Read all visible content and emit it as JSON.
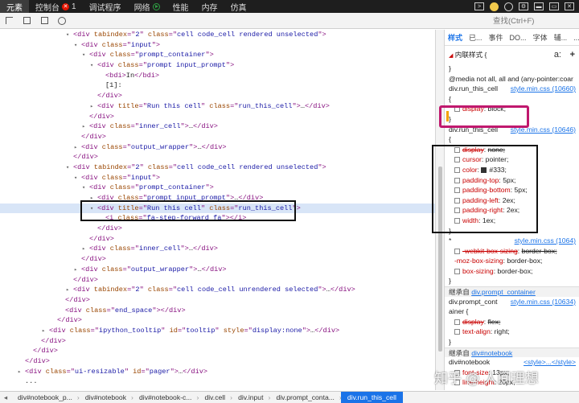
{
  "topbar": {
    "tabs": [
      {
        "label": "元素",
        "active": true
      },
      {
        "label": "控制台",
        "badge": "1",
        "badge_type": "error"
      },
      {
        "label": "调试程序"
      },
      {
        "label": "网络",
        "badge_type": "play"
      },
      {
        "label": "性能"
      },
      {
        "label": "内存"
      },
      {
        "label": "仿真"
      }
    ]
  },
  "toolbar": {
    "search_placeholder": "查找(Ctrl+F)"
  },
  "dom_tree": [
    {
      "indent": 8,
      "tw": "▾",
      "parts": [
        [
          "t",
          "<div "
        ],
        [
          "n",
          "tabindex"
        ],
        [
          "t",
          "=\""
        ],
        [
          "v",
          "2"
        ],
        [
          "t",
          "\" "
        ],
        [
          "n",
          "class"
        ],
        [
          "t",
          "=\""
        ],
        [
          "v",
          "cell code_cell rendered unselected"
        ],
        [
          "t",
          "\">"
        ]
      ]
    },
    {
      "indent": 9,
      "tw": "▾",
      "parts": [
        [
          "t",
          "<div "
        ],
        [
          "n",
          "class"
        ],
        [
          "t",
          "=\""
        ],
        [
          "v",
          "input"
        ],
        [
          "t",
          "\">"
        ]
      ]
    },
    {
      "indent": 10,
      "tw": "▾",
      "parts": [
        [
          "t",
          "<div "
        ],
        [
          "n",
          "class"
        ],
        [
          "t",
          "=\""
        ],
        [
          "v",
          "prompt_container"
        ],
        [
          "t",
          "\">"
        ]
      ]
    },
    {
      "indent": 11,
      "tw": "▾",
      "parts": [
        [
          "t",
          "<div "
        ],
        [
          "n",
          "class"
        ],
        [
          "t",
          "=\""
        ],
        [
          "v",
          "prompt input_prompt"
        ],
        [
          "t",
          "\">"
        ]
      ]
    },
    {
      "indent": 12,
      "tw": "",
      "parts": [
        [
          "t",
          "<bdi>"
        ],
        [
          "x",
          "In"
        ],
        [
          "t",
          "</bdi>"
        ]
      ]
    },
    {
      "indent": 12,
      "tw": "",
      "parts": [
        [
          "x",
          "[1]:"
        ]
      ]
    },
    {
      "indent": 11,
      "tw": "",
      "parts": [
        [
          "t",
          "</div>"
        ]
      ]
    },
    {
      "indent": 11,
      "tw": "▸",
      "parts": [
        [
          "t",
          "<div "
        ],
        [
          "n",
          "title"
        ],
        [
          "t",
          "=\""
        ],
        [
          "v",
          "Run this cell"
        ],
        [
          "t",
          "\" "
        ],
        [
          "n",
          "class"
        ],
        [
          "t",
          "=\""
        ],
        [
          "v",
          "run_this_cell"
        ],
        [
          "t",
          "\">"
        ],
        [
          "x",
          "…"
        ],
        [
          "t",
          "</div>"
        ]
      ]
    },
    {
      "indent": 10,
      "tw": "",
      "parts": [
        [
          "t",
          "</div>"
        ]
      ]
    },
    {
      "indent": 10,
      "tw": "▸",
      "parts": [
        [
          "t",
          "<div "
        ],
        [
          "n",
          "class"
        ],
        [
          "t",
          "=\""
        ],
        [
          "v",
          "inner_cell"
        ],
        [
          "t",
          "\">"
        ],
        [
          "x",
          "…"
        ],
        [
          "t",
          "</div>"
        ]
      ]
    },
    {
      "indent": 9,
      "tw": "",
      "parts": [
        [
          "t",
          "</div>"
        ]
      ]
    },
    {
      "indent": 9,
      "tw": "▸",
      "parts": [
        [
          "t",
          "<div "
        ],
        [
          "n",
          "class"
        ],
        [
          "t",
          "=\""
        ],
        [
          "v",
          "output_wrapper"
        ],
        [
          "t",
          "\">"
        ],
        [
          "x",
          "…"
        ],
        [
          "t",
          "</div>"
        ]
      ]
    },
    {
      "indent": 8,
      "tw": "",
      "parts": [
        [
          "t",
          "</div>"
        ]
      ]
    },
    {
      "indent": 8,
      "tw": "▾",
      "parts": [
        [
          "t",
          "<div "
        ],
        [
          "n",
          "tabindex"
        ],
        [
          "t",
          "=\""
        ],
        [
          "v",
          "2"
        ],
        [
          "t",
          "\" "
        ],
        [
          "n",
          "class"
        ],
        [
          "t",
          "=\""
        ],
        [
          "v",
          "cell code_cell rendered unselected"
        ],
        [
          "t",
          "\">"
        ]
      ]
    },
    {
      "indent": 9,
      "tw": "▾",
      "parts": [
        [
          "t",
          "<div "
        ],
        [
          "n",
          "class"
        ],
        [
          "t",
          "=\""
        ],
        [
          "v",
          "input"
        ],
        [
          "t",
          "\">"
        ]
      ]
    },
    {
      "indent": 10,
      "tw": "▾",
      "parts": [
        [
          "t",
          "<div "
        ],
        [
          "n",
          "class"
        ],
        [
          "t",
          "=\""
        ],
        [
          "v",
          "prompt_container"
        ],
        [
          "t",
          "\">"
        ]
      ]
    },
    {
      "indent": 11,
      "tw": "▸",
      "parts": [
        [
          "t",
          "<div "
        ],
        [
          "n",
          "class"
        ],
        [
          "t",
          "=\""
        ],
        [
          "v",
          "prompt input_prompt"
        ],
        [
          "t",
          "\">"
        ],
        [
          "x",
          "…"
        ],
        [
          "t",
          "</div>"
        ]
      ]
    },
    {
      "indent": 11,
      "tw": "▾",
      "sel": true,
      "parts": [
        [
          "t",
          "<div "
        ],
        [
          "n",
          "title"
        ],
        [
          "t",
          "=\""
        ],
        [
          "v",
          "Run this cell"
        ],
        [
          "t",
          "\" "
        ],
        [
          "n",
          "class"
        ],
        [
          "t",
          "=\""
        ],
        [
          "v",
          "run_this_cell"
        ],
        [
          "t",
          "\">"
        ]
      ]
    },
    {
      "indent": 12,
      "tw": "",
      "parts": [
        [
          "t",
          "<i "
        ],
        [
          "n",
          "class"
        ],
        [
          "t",
          "=\""
        ],
        [
          "v",
          "fa-step-forward fa"
        ],
        [
          "t",
          "\"></i>"
        ]
      ]
    },
    {
      "indent": 11,
      "tw": "",
      "parts": [
        [
          "t",
          "</div>"
        ]
      ]
    },
    {
      "indent": 10,
      "tw": "",
      "parts": [
        [
          "t",
          "</div>"
        ]
      ]
    },
    {
      "indent": 10,
      "tw": "▸",
      "parts": [
        [
          "t",
          "<div "
        ],
        [
          "n",
          "class"
        ],
        [
          "t",
          "=\""
        ],
        [
          "v",
          "inner_cell"
        ],
        [
          "t",
          "\">"
        ],
        [
          "x",
          "…"
        ],
        [
          "t",
          "</div>"
        ]
      ]
    },
    {
      "indent": 9,
      "tw": "",
      "parts": [
        [
          "t",
          "</div>"
        ]
      ]
    },
    {
      "indent": 9,
      "tw": "▸",
      "parts": [
        [
          "t",
          "<div "
        ],
        [
          "n",
          "class"
        ],
        [
          "t",
          "=\""
        ],
        [
          "v",
          "output_wrapper"
        ],
        [
          "t",
          "\">"
        ],
        [
          "x",
          "…"
        ],
        [
          "t",
          "</div>"
        ]
      ]
    },
    {
      "indent": 8,
      "tw": "",
      "parts": [
        [
          "t",
          "</div>"
        ]
      ]
    },
    {
      "indent": 8,
      "tw": "▸",
      "parts": [
        [
          "t",
          "<div "
        ],
        [
          "n",
          "tabindex"
        ],
        [
          "t",
          "=\""
        ],
        [
          "v",
          "2"
        ],
        [
          "t",
          "\" "
        ],
        [
          "n",
          "class"
        ],
        [
          "t",
          "=\""
        ],
        [
          "v",
          "cell code_cell unrendered selected"
        ],
        [
          "t",
          "\">"
        ],
        [
          "x",
          "…"
        ],
        [
          "t",
          "</div>"
        ]
      ]
    },
    {
      "indent": 7,
      "tw": "",
      "parts": [
        [
          "t",
          "</div>"
        ]
      ]
    },
    {
      "indent": 7,
      "tw": "",
      "parts": [
        [
          "t",
          "<div "
        ],
        [
          "n",
          "class"
        ],
        [
          "t",
          "=\""
        ],
        [
          "v",
          "end_space"
        ],
        [
          "t",
          "\"></div>"
        ]
      ]
    },
    {
      "indent": 6,
      "tw": "",
      "parts": [
        [
          "t",
          "</div>"
        ]
      ]
    },
    {
      "indent": 5,
      "tw": "▸",
      "parts": [
        [
          "t",
          "<div "
        ],
        [
          "n",
          "class"
        ],
        [
          "t",
          "=\""
        ],
        [
          "v",
          "ipython_tooltip"
        ],
        [
          "t",
          "\" "
        ],
        [
          "n",
          "id"
        ],
        [
          "t",
          "=\""
        ],
        [
          "v",
          "tooltip"
        ],
        [
          "t",
          "\" "
        ],
        [
          "n",
          "style"
        ],
        [
          "t",
          "=\""
        ],
        [
          "v",
          "display:none"
        ],
        [
          "t",
          "\">"
        ],
        [
          "x",
          "…"
        ],
        [
          "t",
          "</div>"
        ]
      ]
    },
    {
      "indent": 4,
      "tw": "",
      "parts": [
        [
          "t",
          "</div>"
        ]
      ]
    },
    {
      "indent": 3,
      "tw": "",
      "parts": [
        [
          "t",
          "</div>"
        ]
      ]
    },
    {
      "indent": 2,
      "tw": "",
      "parts": [
        [
          "t",
          "</div>"
        ]
      ]
    },
    {
      "indent": 2,
      "tw": "▸",
      "parts": [
        [
          "t",
          "<div "
        ],
        [
          "n",
          "class"
        ],
        [
          "t",
          "=\""
        ],
        [
          "v",
          "ui-resizable"
        ],
        [
          "t",
          "\" "
        ],
        [
          "n",
          "id"
        ],
        [
          "t",
          "=\""
        ],
        [
          "v",
          "pager"
        ],
        [
          "t",
          "\">"
        ],
        [
          "x",
          "…"
        ],
        [
          "t",
          "</div>"
        ]
      ]
    },
    {
      "indent": 2,
      "tw": "",
      "parts": [
        [
          "x",
          "..."
        ]
      ]
    }
  ],
  "styles": {
    "tabs": [
      "样式",
      "已...",
      "事件",
      "DO...",
      "字体",
      "辅...",
      "..."
    ],
    "inline_label": "内联样式 {",
    "toolbar_hov": "a:",
    "toolbar_plus": "+",
    "rows": [
      {
        "type": "plain",
        "text": "}"
      },
      {
        "type": "plain",
        "text": "@media not all, all and (any-pointer:coar"
      },
      {
        "type": "rule",
        "selector": "div.run_this_cell",
        "source": "style.min.css (10660)"
      },
      {
        "type": "plain",
        "text": "{"
      },
      {
        "type": "prop",
        "name": "display",
        "value": "block;"
      },
      {
        "type": "plain",
        "text": "}"
      },
      {
        "type": "rule",
        "selector": "div.run_this_cell",
        "source": "style.min.css (10646)"
      },
      {
        "type": "plain",
        "text": "{"
      },
      {
        "type": "prop",
        "name": "display",
        "value": "none;",
        "strike": true
      },
      {
        "type": "prop",
        "name": "cursor",
        "value": "pointer;"
      },
      {
        "type": "prop",
        "name": "color",
        "value": "#333;",
        "swatch": true
      },
      {
        "type": "prop",
        "name": "padding-top",
        "value": "5px;"
      },
      {
        "type": "prop",
        "name": "padding-bottom",
        "value": "5px;"
      },
      {
        "type": "prop",
        "name": "padding-left",
        "value": "2ex;"
      },
      {
        "type": "prop",
        "name": "padding-right",
        "value": "2ex;"
      },
      {
        "type": "prop",
        "name": "width",
        "value": "1ex;"
      },
      {
        "type": "plain",
        "text": "}"
      },
      {
        "type": "rule",
        "selector": "*",
        "source": "style.min.css (1064)"
      },
      {
        "type": "prop",
        "name": "-webkit-box-sizing",
        "value": "border-box;",
        "strike": true
      },
      {
        "type": "prop",
        "name": "-moz-box-sizing",
        "value": "border-box;",
        "nocb": true
      },
      {
        "type": "prop",
        "name": "box-sizing",
        "value": "border-box;"
      },
      {
        "type": "plain",
        "text": "}"
      },
      {
        "type": "inherit",
        "label": "继承自",
        "link": "div.prompt_container"
      },
      {
        "type": "rule",
        "selector": "div.prompt_cont",
        "source": "style.min.css (10634)"
      },
      {
        "type": "plain",
        "text": "ainer {"
      },
      {
        "type": "prop",
        "name": "display",
        "value": "flex;",
        "strike": true
      },
      {
        "type": "prop",
        "name": "text-align",
        "value": "right;"
      },
      {
        "type": "plain",
        "text": "}"
      },
      {
        "type": "inherit",
        "label": "继承自",
        "link": "div#notebook"
      },
      {
        "type": "rule",
        "selector": "div#notebook",
        "source": "<style>...</style>"
      },
      {
        "type": "prop",
        "name": "font-size",
        "value": "13px;"
      },
      {
        "type": "prop",
        "name": "line-height",
        "value": "20px;"
      },
      {
        "type": "prop",
        "name": "...",
        "value": "..."
      }
    ]
  },
  "breadcrumbs": [
    "div#notebook_p...",
    "div#notebook",
    "div#notebook-c...",
    "div.cell",
    "div.input",
    "div.prompt_conta...",
    "div.run_this_cell"
  ],
  "watermark": "知乎 @ 人间理想"
}
